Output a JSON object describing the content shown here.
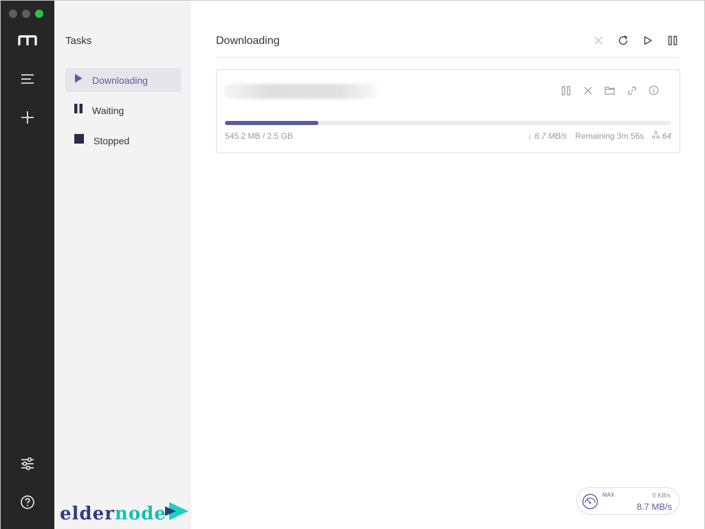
{
  "window": {
    "traffic_colors": [
      "#5e5e5e",
      "#5e5e5e",
      "#2fbf4f"
    ]
  },
  "rail": {
    "items": [
      {
        "icon": "logo-m-icon"
      },
      {
        "icon": "task-list-icon"
      },
      {
        "icon": "add-task-icon"
      },
      {
        "icon": "preferences-sliders-icon"
      },
      {
        "icon": "help-icon"
      }
    ]
  },
  "sidebar": {
    "title": "Tasks",
    "items": [
      {
        "label": "Downloading",
        "icon": "play-icon",
        "active": true
      },
      {
        "label": "Waiting",
        "icon": "pause-icon",
        "active": false
      },
      {
        "label": "Stopped",
        "icon": "stop-icon",
        "active": false
      }
    ]
  },
  "main": {
    "title": "Downloading",
    "toolbar": [
      "delete-icon",
      "refresh-icon",
      "resume-all-icon",
      "pause-all-icon"
    ]
  },
  "task": {
    "name": "",
    "progress_fraction": 0.21,
    "size_text": "545.2 MB / 2.5 GB",
    "speed_text": "8.7 MB/s",
    "remaining_text": "Remaining 3m 56s",
    "connections_text": "64",
    "actions": [
      "pause-icon",
      "close-icon",
      "folder-icon",
      "link-icon",
      "info-icon"
    ]
  },
  "speedometer": {
    "mode_label": "MAX",
    "upload_speed": "0 KB/s",
    "download_speed": "8.7 MB/s"
  },
  "watermark": {
    "text_a": "elder",
    "text_b": "node"
  },
  "colors": {
    "accent": "#5b5ba3",
    "rail_bg": "#262626",
    "sidebar_bg": "#f3f3f3"
  }
}
